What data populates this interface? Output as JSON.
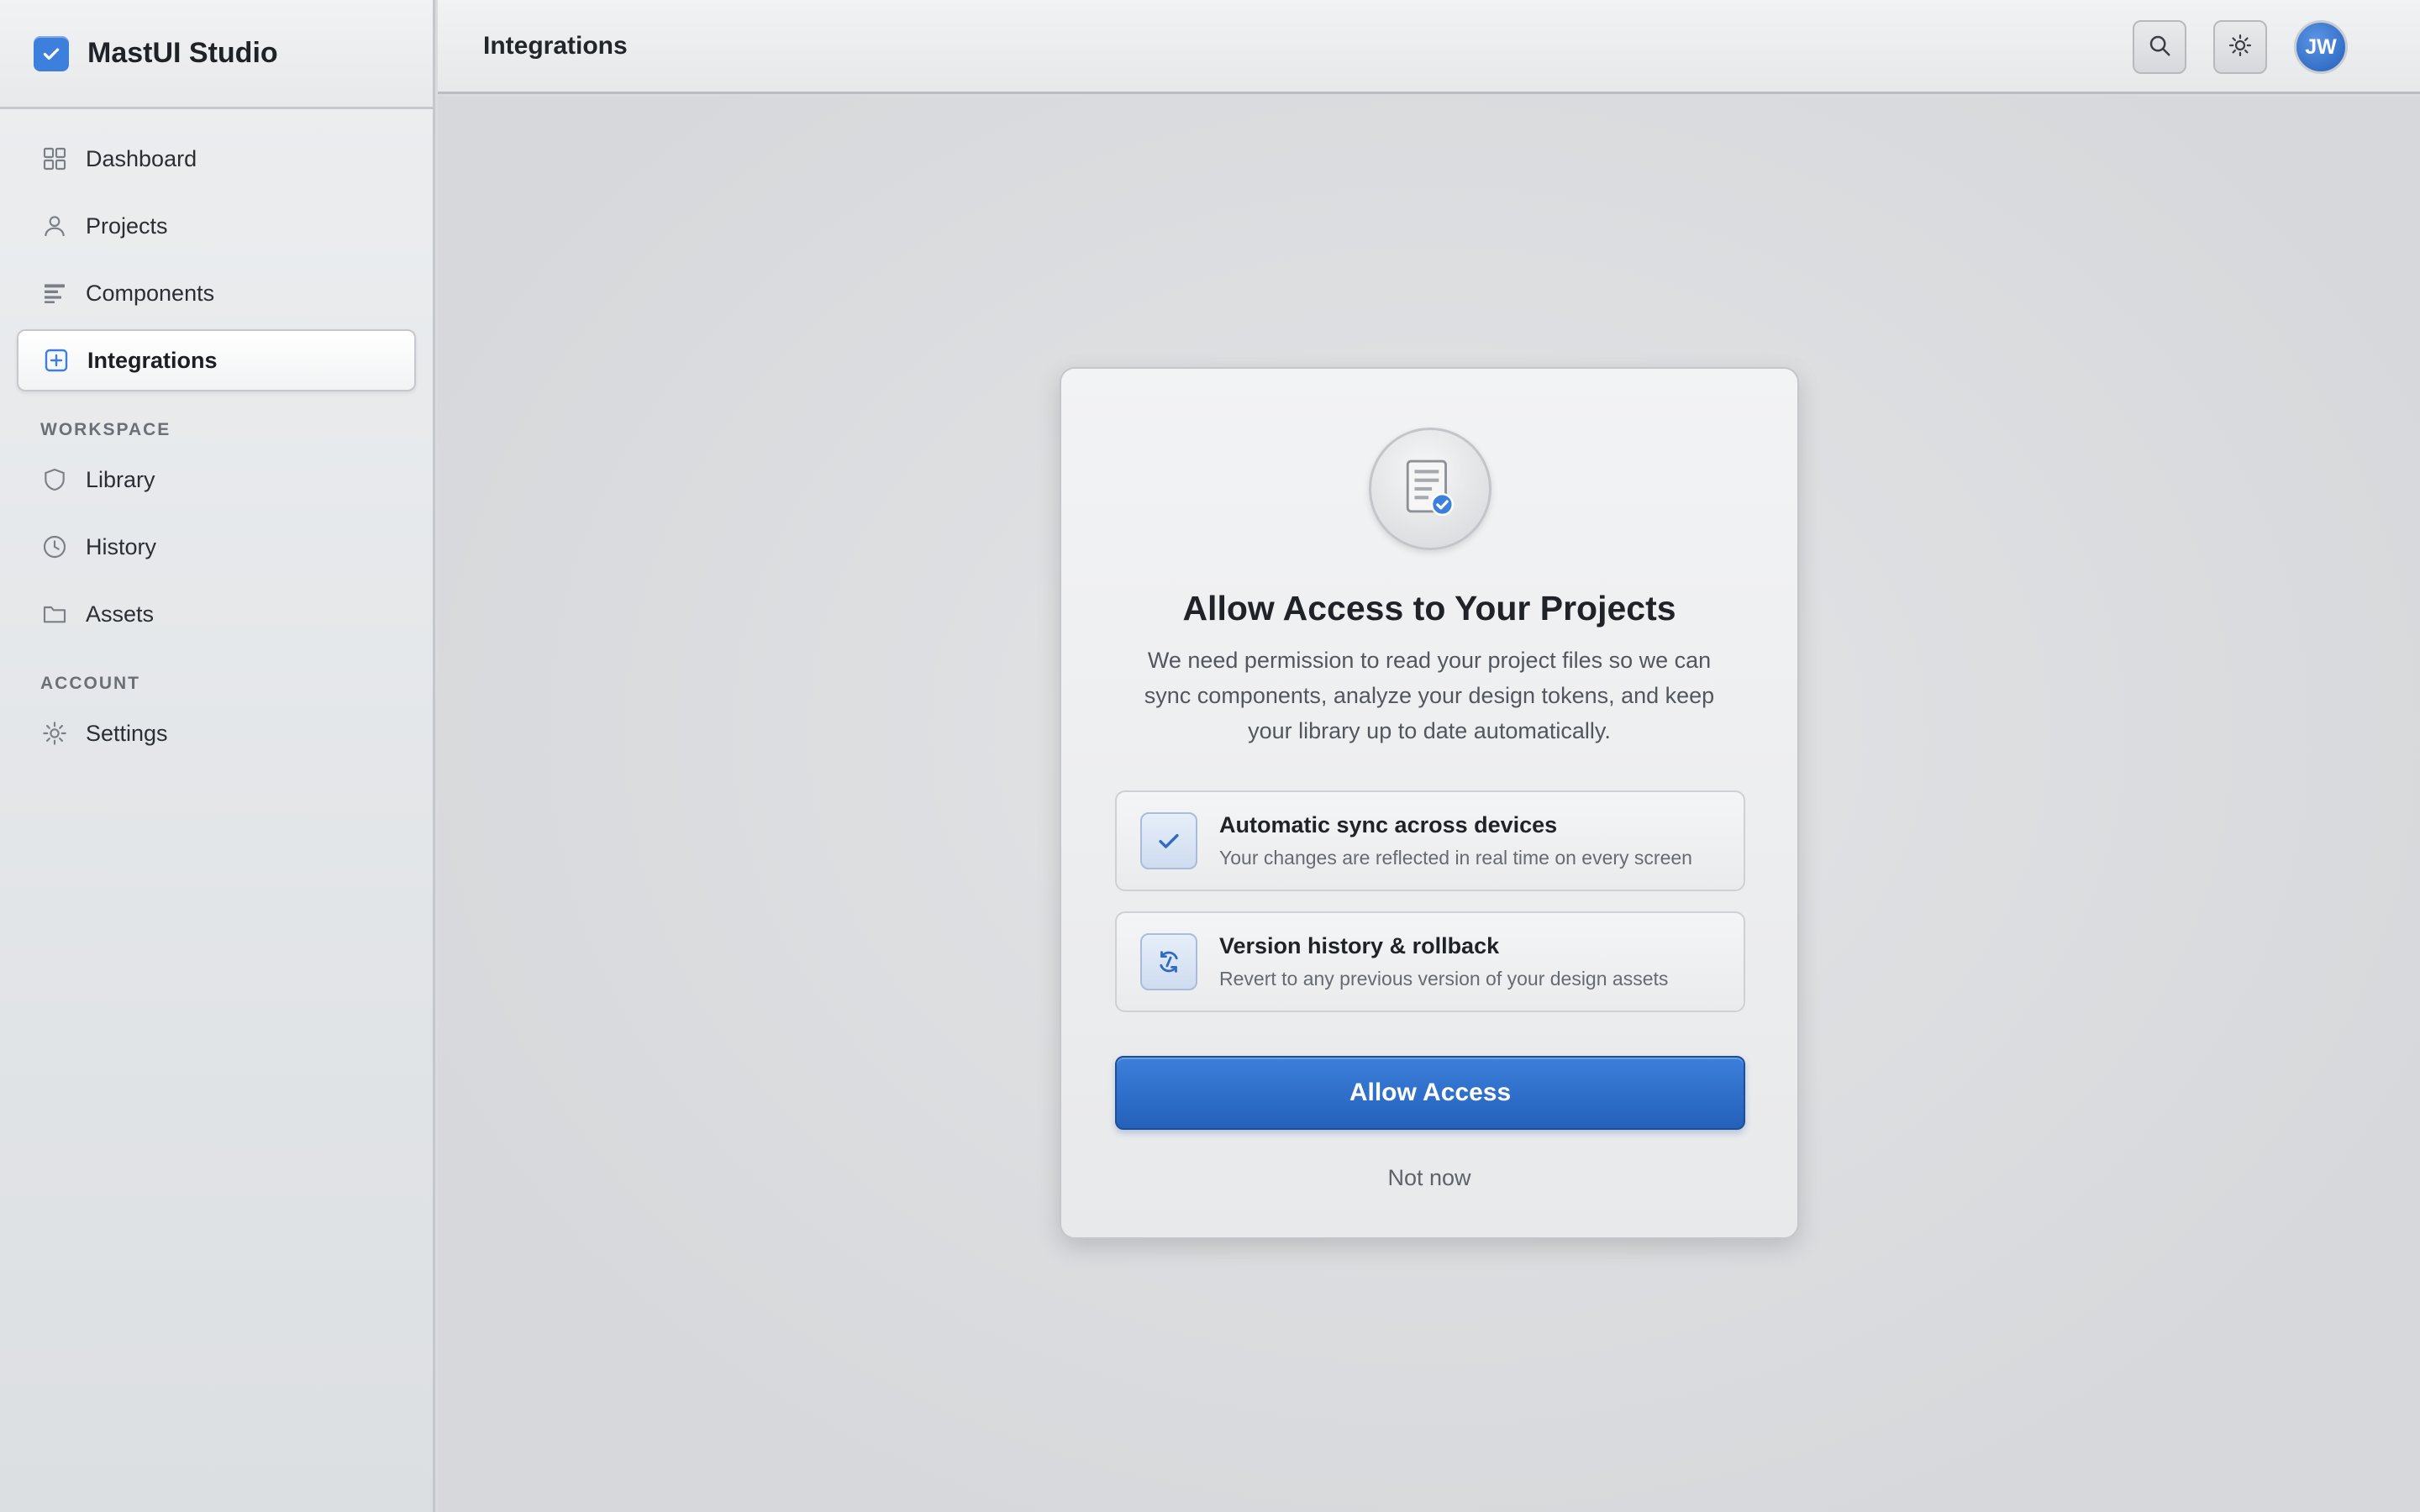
{
  "app": {
    "name": "MastUI Studio"
  },
  "sidebar": {
    "primary_items": [
      {
        "label": "Dashboard",
        "icon": "grid-icon"
      },
      {
        "label": "Projects",
        "icon": "user-icon"
      },
      {
        "label": "Components",
        "icon": "list-icon"
      },
      {
        "label": "Integrations",
        "icon": "plus-square-icon",
        "active": true
      }
    ],
    "workspace_label": "WORKSPACE",
    "workspace_items": [
      {
        "label": "Library",
        "icon": "shield-icon"
      },
      {
        "label": "History",
        "icon": "clock-icon"
      },
      {
        "label": "Assets",
        "icon": "folder-icon"
      }
    ],
    "account_label": "ACCOUNT",
    "account_items": [
      {
        "label": "Settings",
        "icon": "gear-icon"
      }
    ]
  },
  "topbar": {
    "title": "Integrations",
    "avatar_initials": "JW"
  },
  "dialog": {
    "title": "Allow Access to Your Projects",
    "description": "We need permission to read your project files so we can sync components, analyze your design tokens, and keep your library up to date automatically.",
    "features": [
      {
        "title": "Automatic sync across devices",
        "subtitle": "Your changes are reflected in real time on every screen",
        "icon": "check-icon"
      },
      {
        "title": "Version history & rollback",
        "subtitle": "Revert to any previous version of your design assets",
        "icon": "sync-icon"
      }
    ],
    "primary_label": "Allow Access",
    "secondary_label": "Not now"
  },
  "colors": {
    "accent": "#2f6fd0",
    "sidebar_bg": "#e3e5e8",
    "main_bg": "#d9dbde"
  }
}
